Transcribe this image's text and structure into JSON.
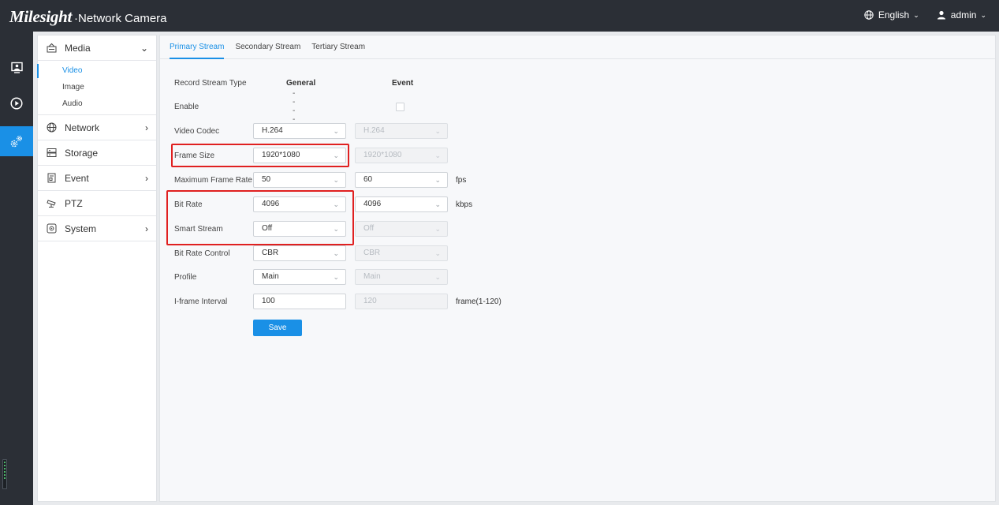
{
  "app": {
    "brand": "Milesight",
    "subtitle": "Network Camera"
  },
  "header": {
    "language": "English",
    "user": "admin"
  },
  "rail": {
    "items": [
      "live-view-icon",
      "playback-icon",
      "settings-icon"
    ],
    "active": "settings-icon"
  },
  "sidebar": {
    "groups": [
      {
        "label": "Media",
        "expanded": true,
        "children": [
          "Video",
          "Image",
          "Audio"
        ],
        "active_child": "Video"
      },
      {
        "label": "Network",
        "has_children": true
      },
      {
        "label": "Storage",
        "has_children": false
      },
      {
        "label": "Event",
        "has_children": true
      },
      {
        "label": "PTZ",
        "has_children": false
      },
      {
        "label": "System",
        "has_children": true
      }
    ]
  },
  "tabs": [
    "Primary Stream",
    "Secondary Stream",
    "Tertiary Stream"
  ],
  "active_tab": "Primary Stream",
  "form": {
    "record_stream_type": {
      "label": "Record Stream Type",
      "general": "General",
      "event": "Event"
    },
    "enable": {
      "label": "Enable",
      "general": "----",
      "event_checked": false
    },
    "video_codec": {
      "label": "Video Codec",
      "general": "H.264",
      "event": "H.264"
    },
    "frame_size": {
      "label": "Frame Size",
      "general": "1920*1080",
      "event": "1920*1080"
    },
    "max_frame_rate": {
      "label": "Maximum Frame Rate",
      "general": "50",
      "event": "60",
      "unit": "fps"
    },
    "bit_rate": {
      "label": "Bit Rate",
      "general": "4096",
      "event": "4096",
      "unit": "kbps"
    },
    "smart_stream": {
      "label": "Smart Stream",
      "general": "Off",
      "event": "Off"
    },
    "bit_rate_control": {
      "label": "Bit Rate Control",
      "general": "CBR",
      "event": "CBR"
    },
    "profile": {
      "label": "Profile",
      "general": "Main",
      "event": "Main"
    },
    "iframe_interval": {
      "label": "I-frame Interval",
      "general": "100",
      "event": "120",
      "unit": "frame(1-120)"
    },
    "save_label": "Save"
  },
  "colors": {
    "accent": "#1a90e6",
    "topbar": "#2b2f36",
    "highlight": "#e02020"
  }
}
